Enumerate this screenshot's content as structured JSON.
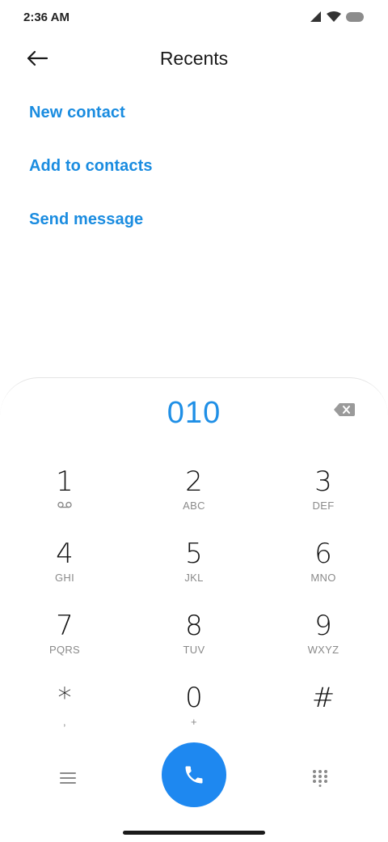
{
  "status_bar": {
    "time": "2:36 AM"
  },
  "header": {
    "title": "Recents"
  },
  "actions": [
    {
      "label": "New contact"
    },
    {
      "label": "Add to contacts"
    },
    {
      "label": "Send message"
    }
  ],
  "dialer": {
    "number": "010",
    "keys": [
      {
        "digit": "1",
        "letters": ""
      },
      {
        "digit": "2",
        "letters": "ABC"
      },
      {
        "digit": "3",
        "letters": "DEF"
      },
      {
        "digit": "4",
        "letters": "GHI"
      },
      {
        "digit": "5",
        "letters": "JKL"
      },
      {
        "digit": "6",
        "letters": "MNO"
      },
      {
        "digit": "7",
        "letters": "PQRS"
      },
      {
        "digit": "8",
        "letters": "TUV"
      },
      {
        "digit": "9",
        "letters": "WXYZ"
      },
      {
        "digit": "*",
        "letters": ","
      },
      {
        "digit": "0",
        "letters": "+"
      },
      {
        "digit": "#",
        "letters": ""
      }
    ]
  },
  "icons": {
    "signal": "signal-icon",
    "wifi": "wifi-icon",
    "battery": "battery-icon",
    "back": "arrow-left-icon",
    "backspace": "backspace-icon",
    "voicemail": "voicemail-icon",
    "menu": "menu-icon",
    "call": "phone-icon",
    "dialpad": "dialpad-icon"
  },
  "colors": {
    "accent": "#1a8ce0",
    "call_button": "#1e88f0",
    "number": "#1f8fe6"
  }
}
